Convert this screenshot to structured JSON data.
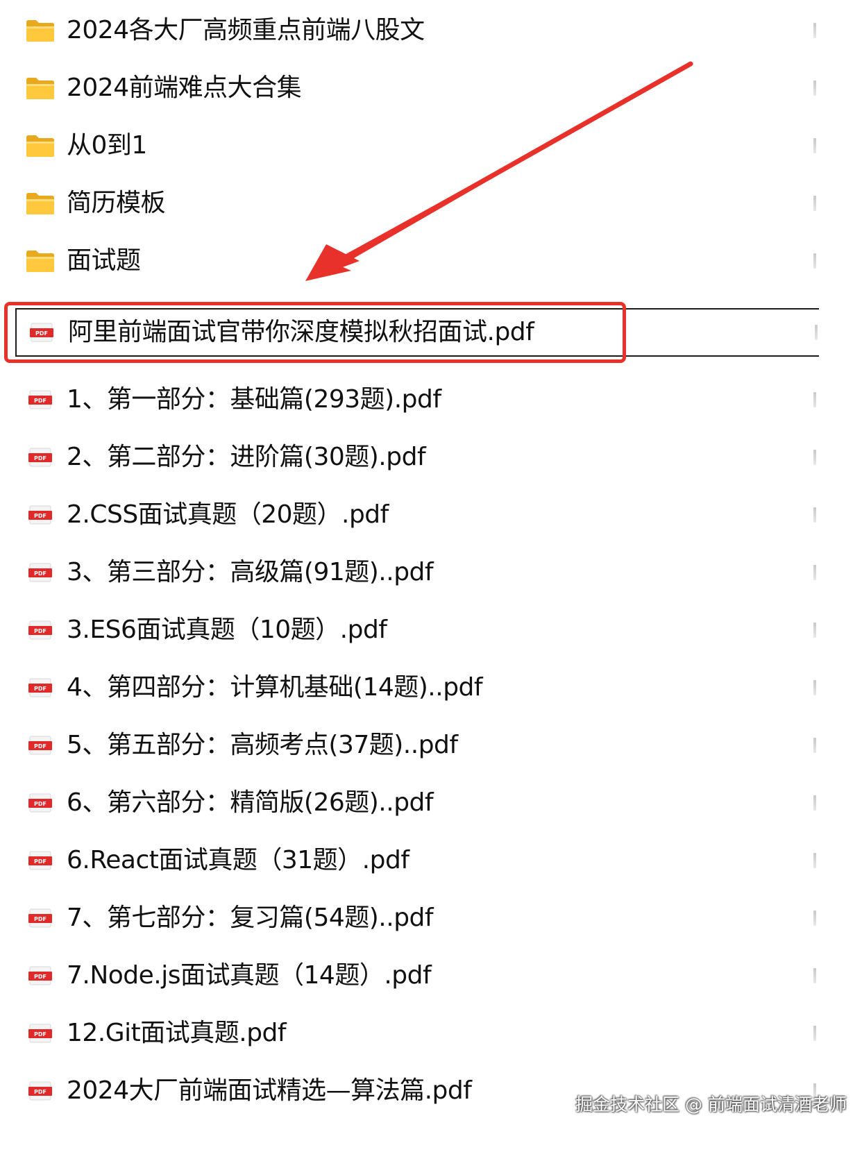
{
  "files": [
    {
      "name": "2024各大厂高频重点前端八股文",
      "type": "folder",
      "icon": "folder-icon"
    },
    {
      "name": "2024前端难点大合集",
      "type": "folder",
      "icon": "folder-icon"
    },
    {
      "name": "从0到1",
      "type": "folder",
      "icon": "folder-icon"
    },
    {
      "name": "简历模板",
      "type": "folder",
      "icon": "folder-icon"
    },
    {
      "name": "面试题",
      "type": "folder",
      "icon": "folder-icon"
    },
    {
      "name": "阿里前端面试官带你深度模拟秋招面试.pdf",
      "type": "pdf",
      "icon": "pdf-icon",
      "selected": true
    },
    {
      "name": "1、第一部分：基础篇(293题).pdf",
      "type": "pdf",
      "icon": "pdf-icon"
    },
    {
      "name": "2、第二部分：进阶篇(30题).pdf",
      "type": "pdf",
      "icon": "pdf-icon"
    },
    {
      "name": "2.CSS面试真题（20题）.pdf",
      "type": "pdf",
      "icon": "pdf-icon"
    },
    {
      "name": "3、第三部分：高级篇(91题)..pdf",
      "type": "pdf",
      "icon": "pdf-icon"
    },
    {
      "name": "3.ES6面试真题（10题）.pdf",
      "type": "pdf",
      "icon": "pdf-icon"
    },
    {
      "name": "4、第四部分：计算机基础(14题)..pdf",
      "type": "pdf",
      "icon": "pdf-icon"
    },
    {
      "name": "5、第五部分：高频考点(37题)..pdf",
      "type": "pdf",
      "icon": "pdf-icon"
    },
    {
      "name": "6、第六部分：精简版(26题)..pdf",
      "type": "pdf",
      "icon": "pdf-icon"
    },
    {
      "name": "6.React面试真题（31题）.pdf",
      "type": "pdf",
      "icon": "pdf-icon"
    },
    {
      "name": "7、第七部分：复习篇(54题)..pdf",
      "type": "pdf",
      "icon": "pdf-icon"
    },
    {
      "name": "7.Node.js面试真题（14题）.pdf",
      "type": "pdf",
      "icon": "pdf-icon"
    },
    {
      "name": "12.Git面试真题.pdf",
      "type": "pdf",
      "icon": "pdf-icon"
    },
    {
      "name": "2024大厂前端面试精选—算法篇.pdf",
      "type": "pdf",
      "icon": "pdf-icon"
    }
  ],
  "pdf_badge": "PDF",
  "annotation": {
    "highlight_color": "#e8312a",
    "arrow_color": "#e8312a"
  },
  "watermark": "掘金技术社区 @ 前端面试清酒老师"
}
